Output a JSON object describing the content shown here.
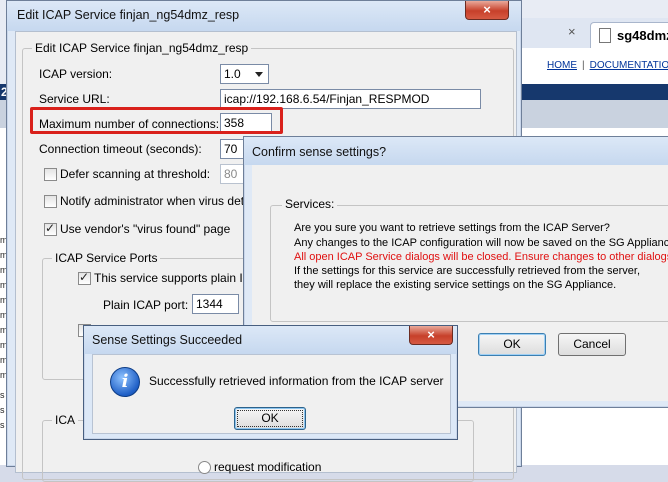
{
  "browser": {
    "tab_label": "sg48dmz",
    "tab_close": "×",
    "links": [
      "HOME",
      "DOCUMENTATION"
    ],
    "navy_char": "2",
    "left_strip_marks": [
      "m",
      "m",
      "m",
      "m",
      "m",
      "m",
      "m",
      "m",
      "m",
      "m",
      "s",
      "s",
      "s"
    ]
  },
  "edit_window": {
    "title": "Edit ICAP Service finjan_ng54dmz_resp",
    "close": "×",
    "group_title": "Edit ICAP Service finjan_ng54dmz_resp",
    "icap_version_label": "ICAP version:",
    "icap_version_value": "1.0",
    "service_url_label": "Service URL:",
    "service_url_value": "icap://192.168.6.54/Finjan_RESPMOD",
    "max_conn_label": "Maximum number of connections:",
    "max_conn_value": "358",
    "timeout_label": "Connection timeout (seconds):",
    "timeout_value": "70",
    "defer_label": "Defer scanning at threshold:",
    "defer_value": "80",
    "notify_label": "Notify administrator when virus dete",
    "vendor_label": "Use vendor's \"virus found\" page",
    "ports_group": "ICAP Service Ports",
    "plain_icap_label": "This service supports plain ICAP",
    "plain_port_label": "Plain ICAP port:",
    "plain_port_value": "1344",
    "lower_group": "ICA",
    "lower_radio_label": "request modification"
  },
  "confirm_window": {
    "title": "Confirm sense settings?",
    "group_title": "Services:",
    "lines": [
      "Are you sure you want to retrieve settings from the ICAP Server?",
      "Any changes to the ICAP configuration will now be saved on the SG Appliance.",
      "All open ICAP Service dialogs will be closed. Ensure changes to other dialogs are",
      "If the settings for this service are successfully retrieved from the server,",
      "they will replace the existing service settings on the SG Appliance."
    ],
    "warning_color": "#e01010",
    "ok": "OK",
    "cancel": "Cancel"
  },
  "sense_window": {
    "title": "Sense Settings Succeeded",
    "close": "×",
    "icon": "information-icon",
    "message": "Successfully retrieved information from the ICAP server",
    "ok": "OK"
  }
}
